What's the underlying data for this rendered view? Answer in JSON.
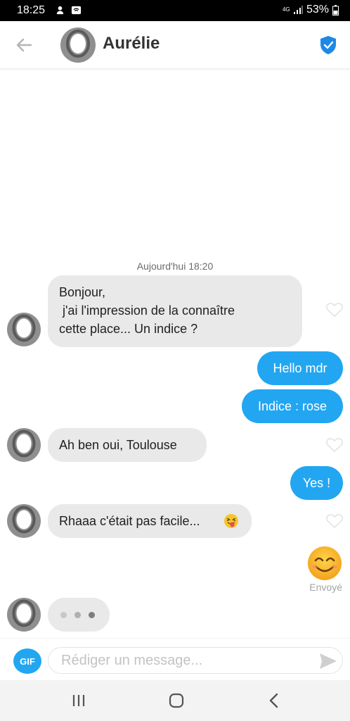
{
  "status_bar": {
    "time": "18:25",
    "network": "4G",
    "battery": "53%"
  },
  "header": {
    "name": "Aurélie"
  },
  "conversation": {
    "timestamp": "Aujourd'hui 18:20",
    "messages": [
      {
        "from": "them",
        "lines": [
          "Bonjour,",
          " j'ai l'impression de la connaître",
          "cette place... Un indice ?"
        ]
      },
      {
        "from": "me",
        "text": "Hello mdr"
      },
      {
        "from": "me",
        "text": "Indice : rose"
      },
      {
        "from": "them",
        "text": "Ah ben oui, Toulouse"
      },
      {
        "from": "me",
        "text": "Yes !"
      },
      {
        "from": "them",
        "text": "Rhaaa c'était pas facile...",
        "emoji": "tongue-wink-emoji"
      },
      {
        "from": "me",
        "emoji": "smiling-face-emoji",
        "status": "Envoyé"
      }
    ],
    "typing_indicator": true
  },
  "composer": {
    "gif_label": "GIF",
    "placeholder": "Rédiger un message..."
  },
  "colors": {
    "accent": "#22a6f2",
    "incoming_bubble": "#e9e9e9",
    "shield": "#1e88e5"
  }
}
